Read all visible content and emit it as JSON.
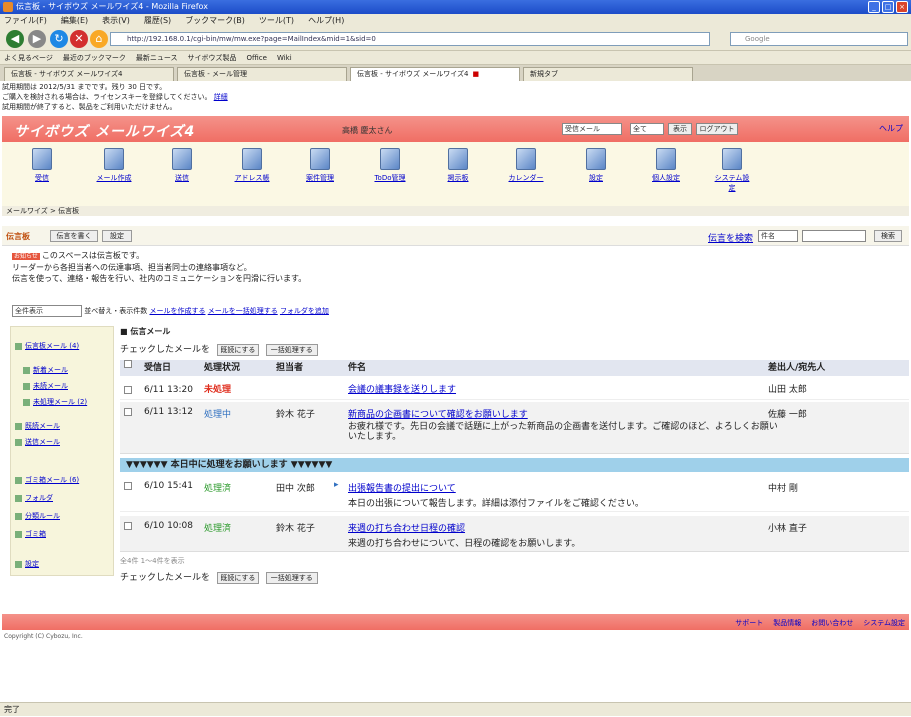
{
  "window": {
    "title": "伝言板 - サイボウズ メールワイズ4 - Mozilla Firefox"
  },
  "menu": [
    "ファイル(F)",
    "編集(E)",
    "表示(V)",
    "履歴(S)",
    "ブックマーク(B)",
    "ツール(T)",
    "ヘルプ(H)"
  ],
  "nav": {
    "url": "http://192.168.0.1/cgi-bin/mw/mw.exe?page=MailIndex&mid=1&sid=0",
    "search": "Google"
  },
  "bookmarks": [
    "よく見るページ",
    "最近のブックマーク",
    "最新ニュース",
    "サイボウズ製品",
    "Office",
    "Wiki"
  ],
  "tabs": [
    "伝言板 - サイボウズ メールワイズ4",
    "伝言板 - メール管理",
    "伝言板 - サイボウズ メールワイズ4",
    "新規タブ"
  ],
  "info_lines": [
    "試用期間は 2012/5/31 までです。残り 30 日です。",
    "ご購入を検討される場合は、ライセンスキーを登録してください。",
    "試用期間が終了すると、製品をご利用いただけません。"
  ],
  "info_link": "詳細",
  "header": {
    "logo": "サイボウズ メールワイズ4",
    "user": "高橋 慶太さん",
    "select1": "受信メール",
    "select2": "全て",
    "btn1": "表示",
    "btn2": "ログアウト",
    "help": "ヘルプ"
  },
  "icons": [
    "受信",
    "メール作成",
    "送信",
    "アドレス帳",
    "案件管理",
    "ToDo管理",
    "掲示板",
    "カレンダー",
    "設定",
    "個人設定",
    "システム設定"
  ],
  "breadcrumb": "メールワイズ > 伝言板",
  "section": {
    "title": "伝言板",
    "btn1": "伝言を書く",
    "btn2": "設定",
    "search_label": "伝言を検索",
    "search_option": "件名",
    "search_btn": "検索"
  },
  "notice_lines": [
    "このスペースは伝言板です。",
    "リーダーから各担当者への伝達事項、担当者同士の連絡事項など。",
    "伝言を使って、連絡・報告を行い、社内のコミュニケーションを円滑に行います。"
  ],
  "toolbar": {
    "select": "全件表示",
    "text": "並べ替え・表示件数",
    "link1": "メールを作成する",
    "link2": "メールを一括処理する",
    "link3": "フォルダを追加"
  },
  "sidebar": [
    "伝言板メール (4)",
    "新着メール",
    "未読メール",
    "未処理メール (2)",
    "既読メール",
    "送信メール",
    "ゴミ箱メール (6)",
    "フォルダ",
    "分類ルール",
    "ゴミ箱",
    "設定"
  ],
  "folder": "伝言メール",
  "bulk": {
    "label": "チェックしたメールを",
    "btn1": "既読にする",
    "btn2": "一括処理する"
  },
  "columns": {
    "date": "受信日",
    "status": "処理状況",
    "owner": "担当者",
    "subject": "件名",
    "from": "差出人/宛先人"
  },
  "mails": [
    {
      "date": "6/11 13:20",
      "status": "未処理",
      "owner": "",
      "subject": "会議の議事録を送りします",
      "from": "山田 太郎",
      "preview": ""
    },
    {
      "date": "6/11 13:12",
      "status": "処理中",
      "owner": "鈴木 花子",
      "subject": "新商品の企画書について確認をお願いします",
      "from": "佐藤 一郎",
      "preview": "お疲れ様です。先日の会議で話題に上がった新商品の企画書を送付します。ご確認のほど、よろしくお願いいたします。"
    },
    {
      "date": "6/10 15:41",
      "status": "処理済",
      "owner": "田中 次郎",
      "subject": "出張報告書の提出について",
      "from": "中村 剛",
      "preview": "本日の出張について報告します。詳細は添付ファイルをご確認ください。"
    },
    {
      "date": "6/10 10:08",
      "status": "処理済",
      "owner": "鈴木 花子",
      "subject": "来週の打ち合わせ日程の確認",
      "from": "小林 直子",
      "preview": "来週の打ち合わせについて、日程の確認をお願いします。"
    }
  ],
  "divider": "▼▼▼▼▼▼  本日中に処理をお願いします  ▼▼▼▼▼▼",
  "pager": "全4件 1～4件を表示",
  "footer": {
    "links": [
      "サポート",
      "製品情報",
      "お問い合わせ",
      "システム設定"
    ],
    "copyright": "Copyright (C) Cybozu, Inc."
  },
  "status": "完了"
}
